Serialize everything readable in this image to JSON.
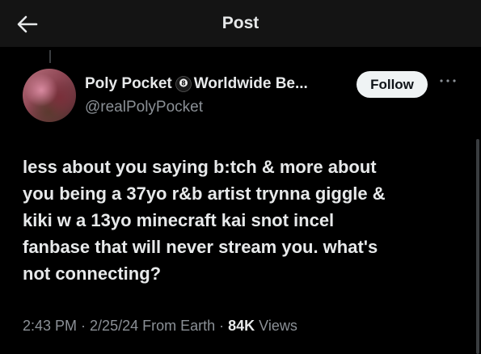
{
  "header": {
    "title": "Post",
    "back_icon": "arrow-left-icon"
  },
  "author": {
    "name": "Poly Pocket",
    "name_emoji": "8-ball-icon",
    "name_suffix": "Worldwide Be...",
    "handle": "@realPolyPocket",
    "follow_label": "Follow",
    "more_icon": "more-horizontal-icon"
  },
  "post": {
    "lines": [
      "less about you saying b:tch & more about",
      "you being a 37yo r&b artist trynna giggle &",
      "kiki w a 13yo minecraft kai snot incel",
      "fanbase that will never stream you. what's",
      "not connecting?"
    ]
  },
  "meta": {
    "time": "2:43 PM",
    "sep1": " · ",
    "date": "2/25/24",
    "location": " From Earth",
    "sep2": " · ",
    "views_count": "84K",
    "views_label": " Views"
  },
  "colors": {
    "background": "#000000",
    "header_bg": "#141414",
    "text_primary": "#e7e9ea",
    "text_secondary": "#8b9096",
    "follow_bg": "#eff3f4",
    "follow_text": "#0f1419"
  }
}
